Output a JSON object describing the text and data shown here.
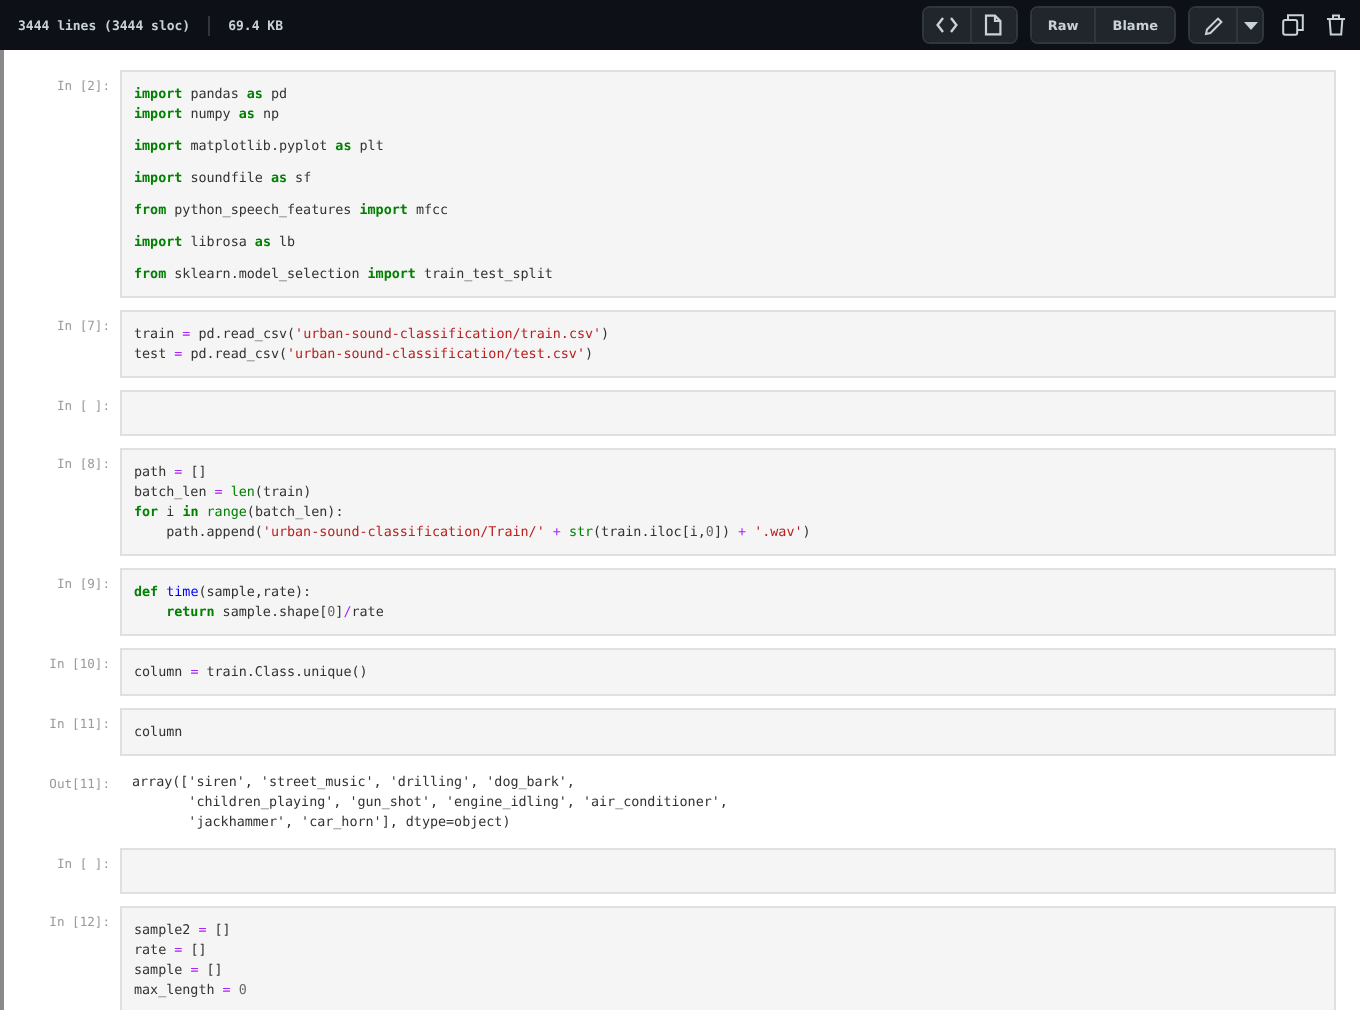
{
  "file_bar": {
    "lines": "3444 lines (3444 sloc)",
    "size": "69.4 KB",
    "buttons": [
      "Raw",
      "Blame"
    ]
  },
  "cells": [
    {
      "kind": "input",
      "prompt": "In [2]:",
      "blocks": [
        [
          [
            {
              "text": "import",
              "kind": "kw"
            },
            {
              "text": " pandas ",
              "kind": "plain"
            },
            {
              "text": "as",
              "kind": "kw"
            },
            {
              "text": " pd",
              "kind": "plain"
            }
          ],
          [
            {
              "text": "import",
              "kind": "kw"
            },
            {
              "text": " numpy ",
              "kind": "plain"
            },
            {
              "text": "as",
              "kind": "kw"
            },
            {
              "text": " np",
              "kind": "plain"
            }
          ]
        ],
        [
          [
            {
              "text": "import",
              "kind": "kw"
            },
            {
              "text": " matplotlib.pyplot ",
              "kind": "plain"
            },
            {
              "text": "as",
              "kind": "kw"
            },
            {
              "text": " plt",
              "kind": "plain"
            }
          ]
        ],
        [
          [
            {
              "text": "import",
              "kind": "kw"
            },
            {
              "text": " soundfile ",
              "kind": "plain"
            },
            {
              "text": "as",
              "kind": "kw"
            },
            {
              "text": " sf",
              "kind": "plain"
            }
          ]
        ],
        [
          [
            {
              "text": "from",
              "kind": "kw"
            },
            {
              "text": " python_speech_features ",
              "kind": "plain"
            },
            {
              "text": "import",
              "kind": "kw"
            },
            {
              "text": " mfcc",
              "kind": "plain"
            }
          ]
        ],
        [
          [
            {
              "text": "import",
              "kind": "kw"
            },
            {
              "text": " librosa ",
              "kind": "plain"
            },
            {
              "text": "as",
              "kind": "kw"
            },
            {
              "text": " lb",
              "kind": "plain"
            }
          ]
        ],
        [
          [
            {
              "text": "from",
              "kind": "kw"
            },
            {
              "text": " sklearn.model_selection ",
              "kind": "plain"
            },
            {
              "text": "import",
              "kind": "kw"
            },
            {
              "text": " train_test_split",
              "kind": "plain"
            }
          ]
        ]
      ]
    },
    {
      "kind": "input",
      "prompt": "In [7]:",
      "blocks": [
        [
          [
            {
              "text": "train ",
              "kind": "plain"
            },
            {
              "text": "=",
              "kind": "op"
            },
            {
              "text": " pd.read_csv(",
              "kind": "plain"
            },
            {
              "text": "'urban-sound-classification/train.csv'",
              "kind": "str"
            },
            {
              "text": ")",
              "kind": "plain"
            }
          ],
          [
            {
              "text": "test ",
              "kind": "plain"
            },
            {
              "text": "=",
              "kind": "op"
            },
            {
              "text": " pd.read_csv(",
              "kind": "plain"
            },
            {
              "text": "'urban-sound-classification/test.csv'",
              "kind": "str"
            },
            {
              "text": ")",
              "kind": "plain"
            }
          ]
        ]
      ]
    },
    {
      "kind": "input",
      "prompt": "In [ ]:"
    },
    {
      "kind": "input",
      "prompt": "In [8]:",
      "blocks": [
        [
          [
            {
              "text": "path ",
              "kind": "plain"
            },
            {
              "text": "=",
              "kind": "op"
            },
            {
              "text": " []",
              "kind": "plain"
            }
          ],
          [
            {
              "text": "batch_len ",
              "kind": "plain"
            },
            {
              "text": "= ",
              "kind": "op"
            },
            {
              "text": "len",
              "kind": "builtin"
            },
            {
              "text": "(train)",
              "kind": "plain"
            }
          ],
          [
            {
              "text": "for",
              "kind": "kw"
            },
            {
              "text": " i ",
              "kind": "plain"
            },
            {
              "text": "in ",
              "kind": "kw"
            },
            {
              "text": "range",
              "kind": "builtin"
            },
            {
              "text": "(batch_len):",
              "kind": "plain"
            }
          ],
          [
            {
              "text": "    path.append(",
              "kind": "plain"
            },
            {
              "text": "'urban-sound-classification/Train/'",
              "kind": "str"
            },
            {
              "text": " + ",
              "kind": "op"
            },
            {
              "text": "str",
              "kind": "builtin"
            },
            {
              "text": "(train.iloc[i,",
              "kind": "plain"
            },
            {
              "text": "0",
              "kind": "num"
            },
            {
              "text": "]) ",
              "kind": "plain"
            },
            {
              "text": "+ ",
              "kind": "op"
            },
            {
              "text": "'.wav'",
              "kind": "str"
            },
            {
              "text": ")",
              "kind": "plain"
            }
          ]
        ]
      ]
    },
    {
      "kind": "input",
      "prompt": "In [9]:",
      "blocks": [
        [
          [
            {
              "text": "def ",
              "kind": "kw"
            },
            {
              "text": "time",
              "kind": "def"
            },
            {
              "text": "(sample,rate):",
              "kind": "plain"
            }
          ],
          [
            {
              "text": "    return",
              "kind": "kw"
            },
            {
              "text": " sample.shape[",
              "kind": "plain"
            },
            {
              "text": "0",
              "kind": "num"
            },
            {
              "text": "]",
              "kind": "plain"
            },
            {
              "text": "/",
              "kind": "op"
            },
            {
              "text": "rate",
              "kind": "plain"
            }
          ]
        ]
      ]
    },
    {
      "kind": "input",
      "prompt": "In [10]:",
      "blocks": [
        [
          [
            {
              "text": "column ",
              "kind": "plain"
            },
            {
              "text": "=",
              "kind": "op"
            },
            {
              "text": " train.Class.unique()",
              "kind": "plain"
            }
          ]
        ]
      ]
    },
    {
      "kind": "input",
      "prompt": "In [11]:",
      "blocks": [
        [
          [
            {
              "text": "column",
              "kind": "plain"
            }
          ]
        ]
      ]
    },
    {
      "kind": "output",
      "prompt": "Out[11]:",
      "blocks": [
        [
          [
            {
              "text": "array(['siren', 'street_music', 'drilling', 'dog_bark',",
              "kind": "plain"
            }
          ],
          [
            {
              "text": "       'children_playing', 'gun_shot', 'engine_idling', 'air_conditioner',",
              "kind": "plain"
            }
          ],
          [
            {
              "text": "       'jackhammer', 'car_horn'], dtype=object)",
              "kind": "plain"
            }
          ]
        ]
      ]
    },
    {
      "kind": "input",
      "prompt": "In [ ]:"
    },
    {
      "kind": "input",
      "prompt": "In [12]:",
      "blocks": [
        [
          [
            {
              "text": "sample2 ",
              "kind": "plain"
            },
            {
              "text": "=",
              "kind": "op"
            },
            {
              "text": " []",
              "kind": "plain"
            }
          ],
          [
            {
              "text": "rate ",
              "kind": "plain"
            },
            {
              "text": "=",
              "kind": "op"
            },
            {
              "text": " []",
              "kind": "plain"
            }
          ],
          [
            {
              "text": "sample ",
              "kind": "plain"
            },
            {
              "text": "=",
              "kind": "op"
            },
            {
              "text": " []",
              "kind": "plain"
            }
          ],
          [
            {
              "text": "max_length ",
              "kind": "plain"
            },
            {
              "text": "= ",
              "kind": "op"
            },
            {
              "text": "0",
              "kind": "num"
            }
          ]
        ]
      ]
    }
  ]
}
